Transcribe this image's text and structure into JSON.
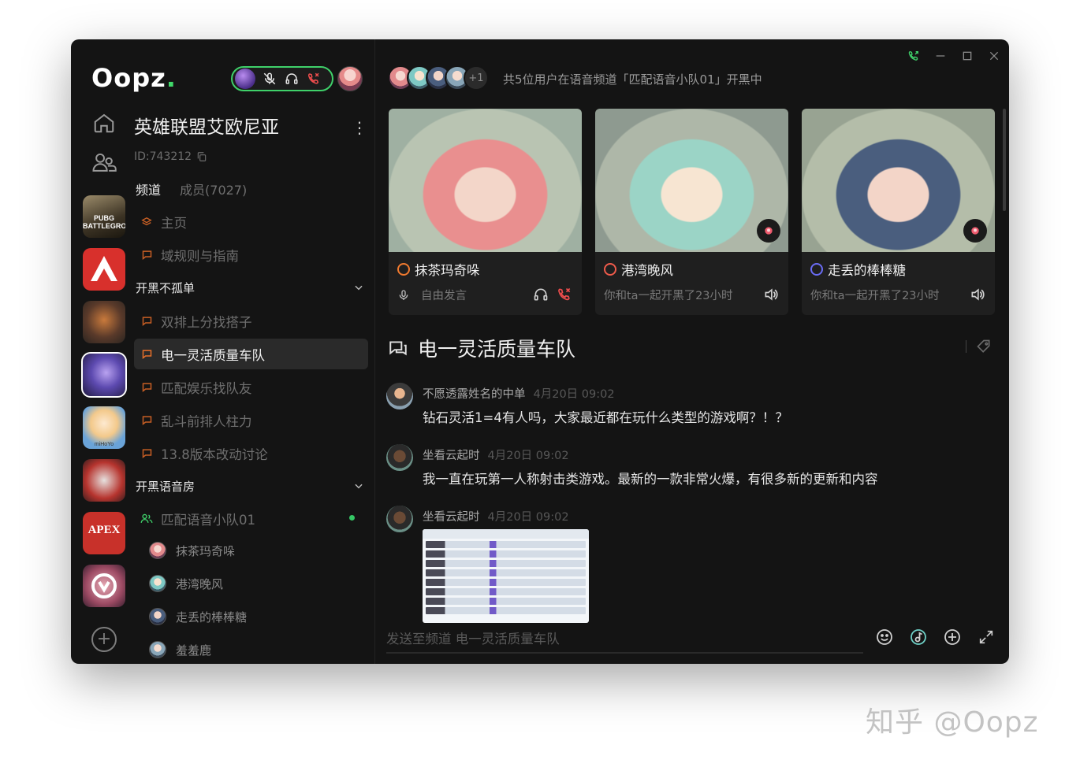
{
  "app": {
    "logo": "Oopz",
    "logo_dot": "."
  },
  "server": {
    "name": "英雄联盟艾欧尼亚",
    "id": "ID:743212",
    "tabs": [
      "频道",
      "成员(7027)"
    ]
  },
  "channels": {
    "top": [
      {
        "label": "主页",
        "icon": "layers-icon"
      },
      {
        "label": "域规则与指南",
        "icon": "chat-icon"
      }
    ],
    "group1": {
      "title": "开黑不孤单",
      "items": [
        {
          "label": "双排上分找搭子"
        },
        {
          "label": "电一灵活质量车队",
          "active": true
        },
        {
          "label": "匹配娱乐找队友"
        },
        {
          "label": "乱斗前排人柱力"
        },
        {
          "label": "13.8版本改动讨论"
        }
      ]
    },
    "group2": {
      "title": "开黑语音房",
      "voice_channel": "匹配语音小队01",
      "members": [
        "抹茶玛奇哚",
        "港湾晚风",
        "走丢的棒棒糖",
        "羞羞鹿"
      ]
    }
  },
  "voice_bar": {
    "overflow_count": "+1",
    "status": "共5位用户在语音频道「匹配语音小队01」开黑中"
  },
  "video_cards": [
    {
      "name": "抹茶玛奇哚",
      "sub": "自由发言",
      "ring_color": "#f07a2f"
    },
    {
      "name": "港湾晚风",
      "sub": "你和ta一起开黑了23小时",
      "ring_color": "#ef5b4b"
    },
    {
      "name": "走丢的棒棒糖",
      "sub": "你和ta一起开黑了23小时",
      "ring_color": "#6a6cf5"
    }
  ],
  "chat": {
    "title": "电一灵活质量车队",
    "messages": [
      {
        "author": "不愿透露姓名的中单",
        "time": "4月20日 09:02",
        "text": "钻石灵活1=4有人吗，大家最近都在玩什么类型的游戏啊？！？"
      },
      {
        "author": "坐看云起时",
        "time": "4月20日 09:02",
        "text": "我一直在玩第一人称射击类游戏。最新的一款非常火爆，有很多新的更新和内容"
      },
      {
        "author": "坐看云起时",
        "time": "4月20日 09:02",
        "text": ""
      }
    ],
    "composer_placeholder": "发送至频道 电一灵活质量车队"
  },
  "watermark": "知乎 @Oopz",
  "colors": {
    "accent": "#40d96a",
    "orange": "#e8702a",
    "bg": "#141414"
  }
}
